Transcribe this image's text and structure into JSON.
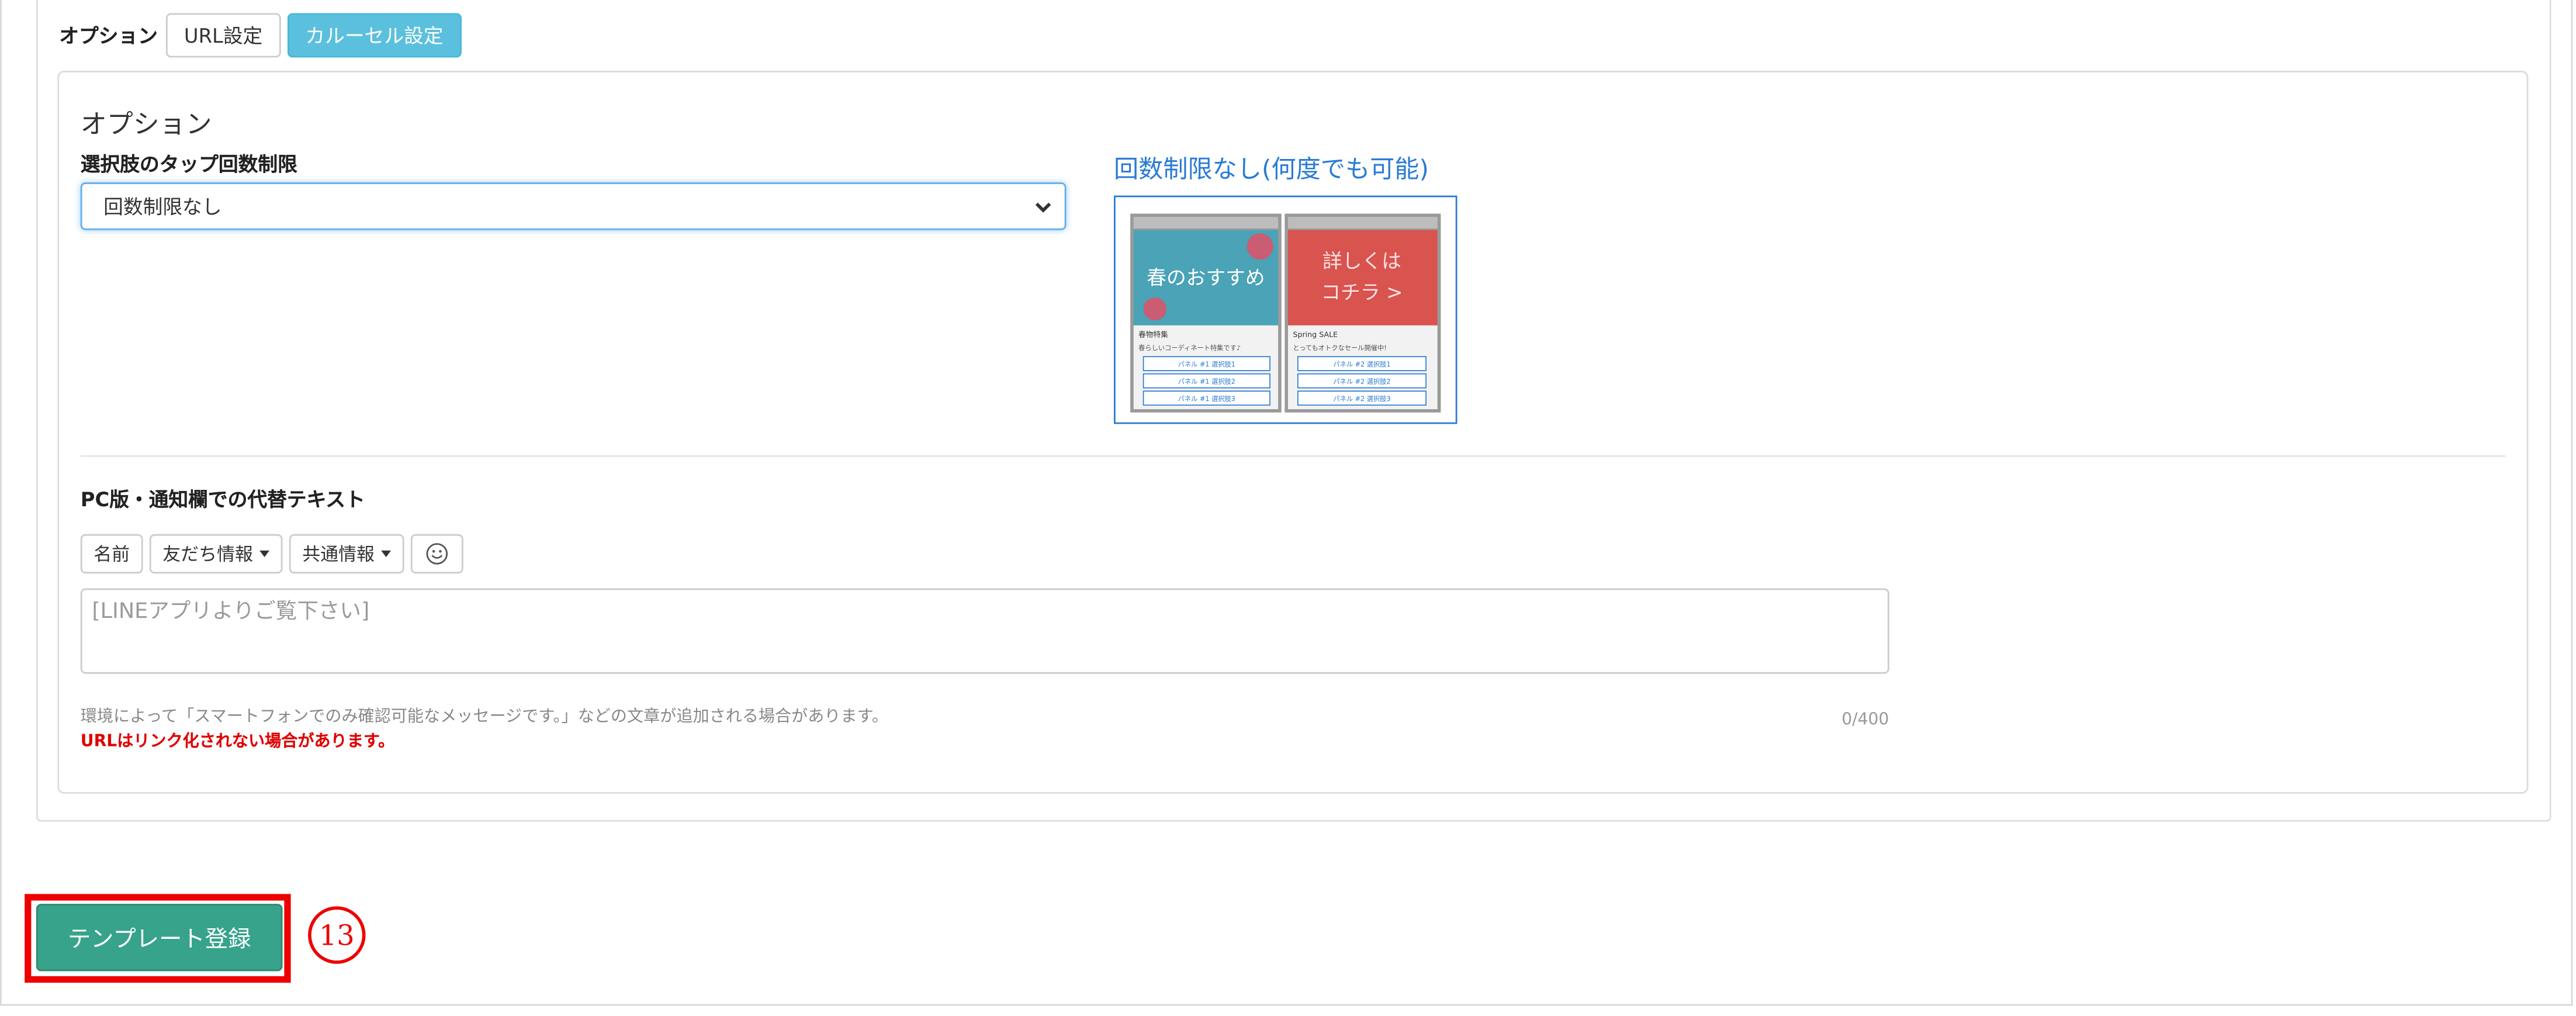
{
  "tabs": {
    "label": "オプション",
    "url_settings": "URL設定",
    "carousel_settings": "カルーセル設定"
  },
  "option_panel": {
    "heading": "オプション",
    "tap_limit": {
      "label": "選択肢のタップ回数制限",
      "selected": "回数制限なし"
    },
    "preview": {
      "title": "回数制限なし(何度でも可能)",
      "panel1_headline": "春のおすすめ",
      "panel1_caption": "春物特集",
      "panel1_sub": "春らしいコーディネート特集です♪",
      "panel1_choices": [
        "パネル #1 選択肢1",
        "パネル #1 選択肢2",
        "パネル #1 選択肢3"
      ],
      "panel2_headline_1": "詳しくは",
      "panel2_headline_2": "コチラ >",
      "panel2_caption": "Spring SALE",
      "panel2_sub": "とってもオトクなセール開催中!",
      "panel2_choices": [
        "パネル #2 選択肢1",
        "パネル #2 選択肢2",
        "パネル #2 選択肢3"
      ]
    },
    "alt_text": {
      "label": "PC版・通知欄での代替テキスト",
      "buttons": {
        "name": "名前",
        "friend_info": "友だち情報",
        "common_info": "共通情報"
      },
      "emoji_icon": "smiley-icon",
      "placeholder": "[LINEアプリよりご覧下さい]",
      "help": "環境によって「スマートフォンでのみ確認可能なメッセージです。」などの文章が追加される場合があります。",
      "warning": "URLはリンク化されない場合があります。",
      "counter": "0/400"
    }
  },
  "footer": {
    "submit_label": "テンプレート登録",
    "step_number": "13"
  },
  "colors": {
    "primary_info": "#5bc0de",
    "submit_green": "#37a38a",
    "highlight_red": "#ee0000",
    "preview_blue": "#2a7bd4",
    "warning_red": "#e00000"
  }
}
